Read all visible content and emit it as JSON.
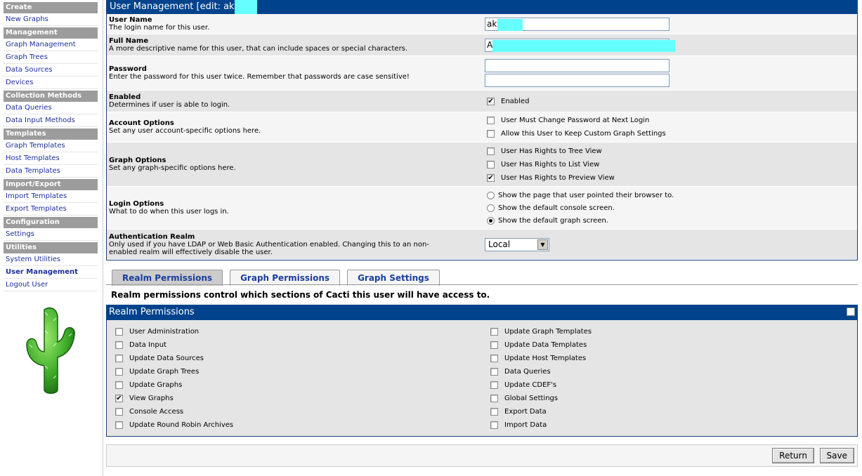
{
  "sidebar": {
    "sections": [
      {
        "header": "Create",
        "items": [
          {
            "label": "New Graphs"
          }
        ]
      },
      {
        "header": "Management",
        "items": [
          {
            "label": "Graph Management"
          },
          {
            "label": "Graph Trees"
          },
          {
            "label": "Data Sources"
          },
          {
            "label": "Devices"
          }
        ]
      },
      {
        "header": "Collection Methods",
        "items": [
          {
            "label": "Data Queries"
          },
          {
            "label": "Data Input Methods"
          }
        ]
      },
      {
        "header": "Templates",
        "items": [
          {
            "label": "Graph Templates"
          },
          {
            "label": "Host Templates"
          },
          {
            "label": "Data Templates"
          }
        ]
      },
      {
        "header": "Import/Export",
        "items": [
          {
            "label": "Import Templates"
          },
          {
            "label": "Export Templates"
          }
        ]
      },
      {
        "header": "Configuration",
        "items": [
          {
            "label": "Settings"
          }
        ]
      },
      {
        "header": "Utilities",
        "items": [
          {
            "label": "System Utilities"
          },
          {
            "label": "User Management"
          },
          {
            "label": "Logout User"
          }
        ]
      }
    ],
    "active_item": "User Management"
  },
  "form": {
    "title": "User Management [edit: ak",
    "user_name": {
      "label": "User Name",
      "desc": "The login name for this user.",
      "value": "ak"
    },
    "full_name": {
      "label": "Full Name",
      "desc": "A more descriptive name for this user, that can include spaces or special characters.",
      "value": "A"
    },
    "password": {
      "label": "Password",
      "desc": "Enter the password for this user twice. Remember that passwords are case sensitive!"
    },
    "enabled": {
      "label": "Enabled",
      "desc": "Determines if user is able to login.",
      "option": "Enabled",
      "checked": true
    },
    "account_options": {
      "label": "Account Options",
      "desc": "Set any user account-specific options here.",
      "options": [
        {
          "label": "User Must Change Password at Next Login",
          "checked": false
        },
        {
          "label": "Allow this User to Keep Custom Graph Settings",
          "checked": false
        }
      ]
    },
    "graph_options": {
      "label": "Graph Options",
      "desc": "Set any graph-specific options here.",
      "options": [
        {
          "label": "User Has Rights to Tree View",
          "checked": false
        },
        {
          "label": "User Has Rights to List View",
          "checked": false
        },
        {
          "label": "User Has Rights to Preview View",
          "checked": true
        }
      ]
    },
    "login_options": {
      "label": "Login Options",
      "desc": "What to do when this user logs in.",
      "options": [
        {
          "label": "Show the page that user pointed their browser to.",
          "selected": false
        },
        {
          "label": "Show the default console screen.",
          "selected": false
        },
        {
          "label": "Show the default graph screen.",
          "selected": true
        }
      ]
    },
    "auth_realm": {
      "label": "Authentication Realm",
      "desc": "Only used if you have LDAP or Web Basic Authentication enabled. Changing this to an non-enabled realm will effectively disable the user.",
      "value": "Local"
    }
  },
  "tabs": [
    {
      "label": "Realm Permissions",
      "active": true
    },
    {
      "label": "Graph Permissions",
      "active": false
    },
    {
      "label": "Graph Settings",
      "active": false
    }
  ],
  "realm": {
    "description": "Realm permissions control which sections of Cacti this user will have access to.",
    "title": "Realm Permissions",
    "left": [
      {
        "label": "User Administration",
        "checked": false
      },
      {
        "label": "Data Input",
        "checked": false
      },
      {
        "label": "Update Data Sources",
        "checked": false
      },
      {
        "label": "Update Graph Trees",
        "checked": false
      },
      {
        "label": "Update Graphs",
        "checked": false
      },
      {
        "label": "View Graphs",
        "checked": true
      },
      {
        "label": "Console Access",
        "checked": false
      },
      {
        "label": "Update Round Robin Archives",
        "checked": false
      }
    ],
    "right": [
      {
        "label": "Update Graph Templates",
        "checked": false
      },
      {
        "label": "Update Data Templates",
        "checked": false
      },
      {
        "label": "Update Host Templates",
        "checked": false
      },
      {
        "label": "Data Queries",
        "checked": false
      },
      {
        "label": "Update CDEF's",
        "checked": false
      },
      {
        "label": "Global Settings",
        "checked": false
      },
      {
        "label": "Export Data",
        "checked": false
      },
      {
        "label": "Import Data",
        "checked": false
      }
    ]
  },
  "buttons": {
    "return_label": "Return",
    "save_label": "Save"
  },
  "colors": {
    "header_bg": "#00438c",
    "menu_header_bg": "#9c9c9c",
    "link": "#1d2f9e",
    "redaction": "#66ffff"
  }
}
